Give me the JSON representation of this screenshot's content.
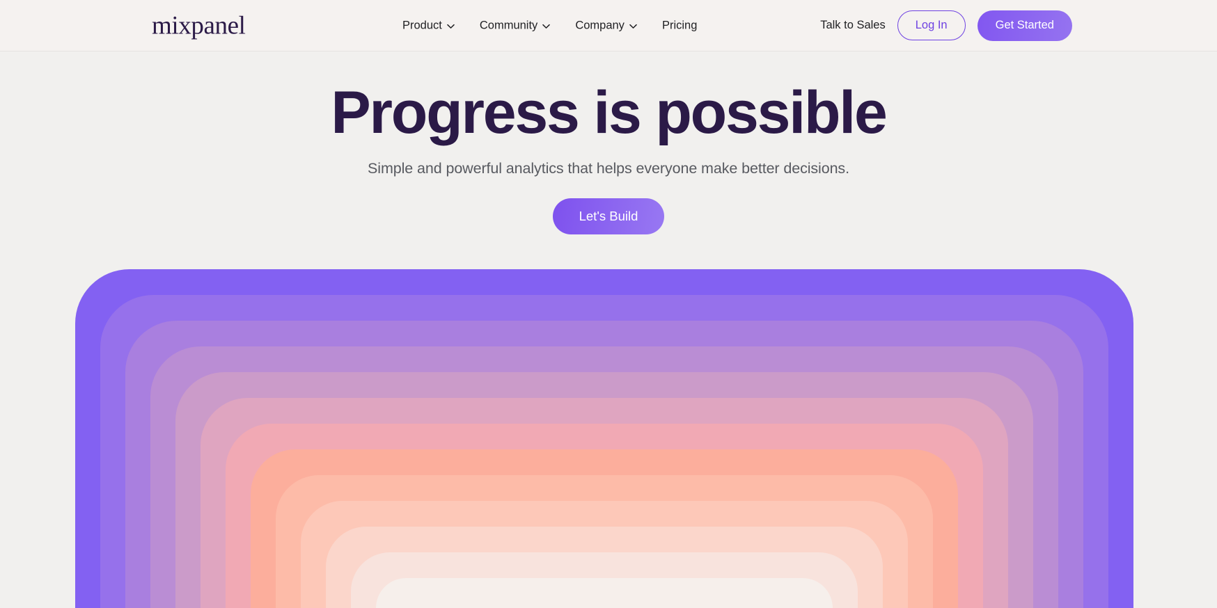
{
  "header": {
    "logo_text": "mixpanel",
    "nav_items": [
      {
        "label": "Product",
        "icon": "chevron-down-icon",
        "has_chevron": true
      },
      {
        "label": "Community",
        "icon": "chevron-down-icon",
        "has_chevron": true
      },
      {
        "label": "Company",
        "icon": "chevron-down-icon",
        "has_chevron": true
      },
      {
        "label": "Pricing",
        "icon": "",
        "has_chevron": false
      }
    ],
    "talk_to_sales_label": "Talk to Sales",
    "login_label": "Log In",
    "get_started_label": "Get Started"
  },
  "hero": {
    "title": "Progress is possible",
    "subtitle": "Simple and powerful analytics that helps everyone make better decisions.",
    "cta_label": "Let's Build"
  },
  "colors": {
    "page_background": "#F1F0EE",
    "header_background": "#F5F2F0",
    "header_border": "#E6E2E0",
    "brand_purple": "#6E41E2",
    "heading_text": "#2B1A47",
    "body_text": "#585A60",
    "nav_text": "#1F1F22",
    "button_text": "#FFFFFF"
  },
  "bands": {
    "count": 13,
    "left_start": 108,
    "right_start": 1628,
    "top_start": 387,
    "step_x": 36,
    "step_y": 37,
    "corner_radius": 78,
    "colors": [
      "#8361F2",
      "#9671EB",
      "#A97FDF",
      "#BA8DD4",
      "#CB9BC9",
      "#DFA5C0",
      "#F1A9B4",
      "#FCAE9C",
      "#FDBBA8",
      "#FDC8B8",
      "#FBD6CB",
      "#F8E3DD",
      "#F6EFEB"
    ]
  }
}
